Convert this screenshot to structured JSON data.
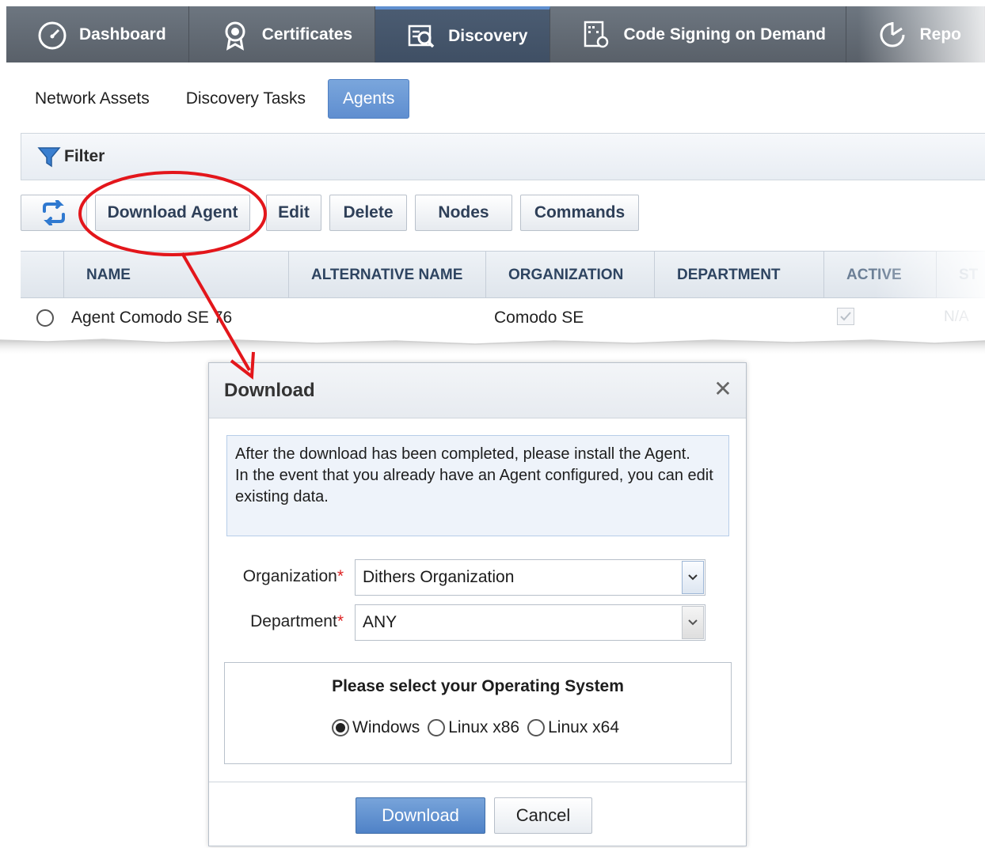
{
  "topnav": {
    "items": [
      {
        "label": "Dashboard",
        "icon": "speedometer-icon",
        "active": false
      },
      {
        "label": "Certificates",
        "icon": "certificate-badge-icon",
        "active": false
      },
      {
        "label": "Discovery",
        "icon": "discovery-magnifier-icon",
        "active": true
      },
      {
        "label": "Code Signing on Demand",
        "icon": "code-signing-icon",
        "active": false
      },
      {
        "label": "Repo",
        "icon": "reports-chart-icon",
        "active": false
      }
    ]
  },
  "subtabs": {
    "items": [
      {
        "label": "Network Assets",
        "active": false
      },
      {
        "label": "Discovery Tasks",
        "active": false
      },
      {
        "label": "Agents",
        "active": true
      }
    ]
  },
  "filter": {
    "label": "Filter",
    "icon": "funnel-icon"
  },
  "toolbar": {
    "refresh_icon": "refresh-icon",
    "download_agent": "Download Agent",
    "edit": "Edit",
    "delete": "Delete",
    "nodes": "Nodes",
    "commands": "Commands"
  },
  "grid": {
    "columns": [
      "NAME",
      "ALTERNATIVE NAME",
      "ORGANIZATION",
      "DEPARTMENT",
      "ACTIVE",
      "ST"
    ],
    "rows": [
      {
        "name": "Agent Comodo SE 76",
        "alternative_name": "",
        "organization": "Comodo SE",
        "department": "",
        "active": true,
        "status": "N/A"
      }
    ]
  },
  "dialog": {
    "title": "Download",
    "info_line1": "After the download has been completed, please install the Agent.",
    "info_line2": "In the event that you already have an Agent configured, you can edit existing data.",
    "organization_label": "Organization",
    "organization_value": "Dithers Organization",
    "department_label": "Department",
    "department_value": "ANY",
    "required_mark": "*",
    "os_title": "Please select your Operating System",
    "os_options": [
      {
        "label": "Windows",
        "selected": true
      },
      {
        "label": "Linux x86",
        "selected": false
      },
      {
        "label": "Linux x64",
        "selected": false
      }
    ],
    "download_button": "Download",
    "cancel_button": "Cancel"
  },
  "colors": {
    "nav_bg": "#5f6770",
    "nav_active_bg": "#44546a",
    "accent_blue": "#5f8ed0",
    "annotation_red": "#e3161b"
  }
}
